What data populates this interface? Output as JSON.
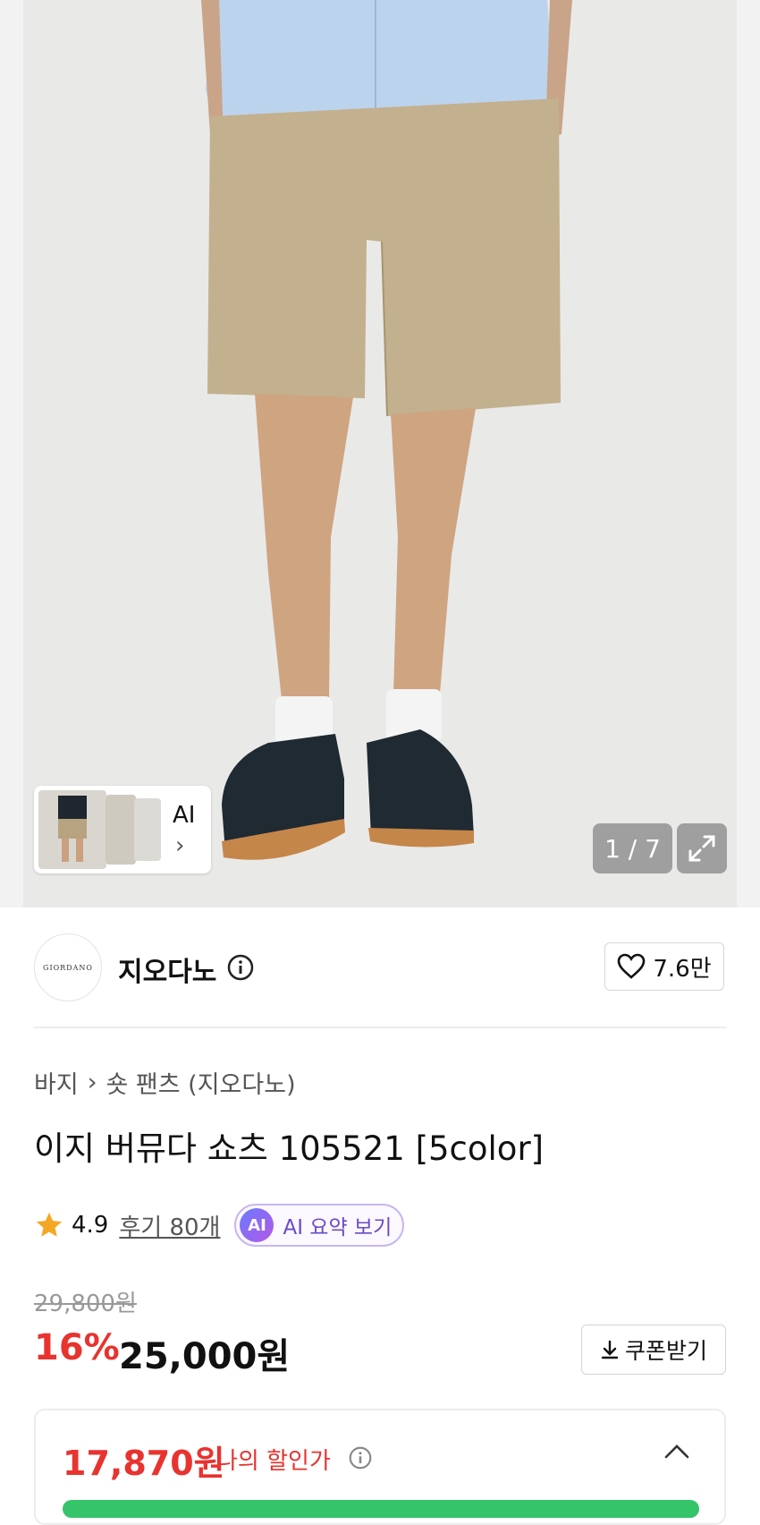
{
  "gallery": {
    "counter": "1 / 7",
    "thumb_label": "AI",
    "thumb_chevron": "›"
  },
  "brand": {
    "logo_text": "GIORDANO",
    "name": "지오다노",
    "likes": "7.6만"
  },
  "breadcrumb": {
    "category": "바지",
    "separator": "›",
    "subcategory": "숏 팬츠 (지오다노)"
  },
  "product": {
    "title": "이지 버뮤다 쇼츠 105521 [5color]",
    "rating": "4.9",
    "review_link": "후기 80개",
    "ai_badge": "AI",
    "ai_summary": "AI 요약 보기"
  },
  "price": {
    "original": "29,800원",
    "discount": "16%",
    "sale": "25,000원",
    "coupon_label": "쿠폰받기",
    "my_price": "17,870원",
    "my_price_label": "나의 할인가"
  },
  "colors": {
    "discount_red": "#e8332f",
    "ai_purple": "#6a4ac9",
    "star_orange": "#f5a623"
  }
}
